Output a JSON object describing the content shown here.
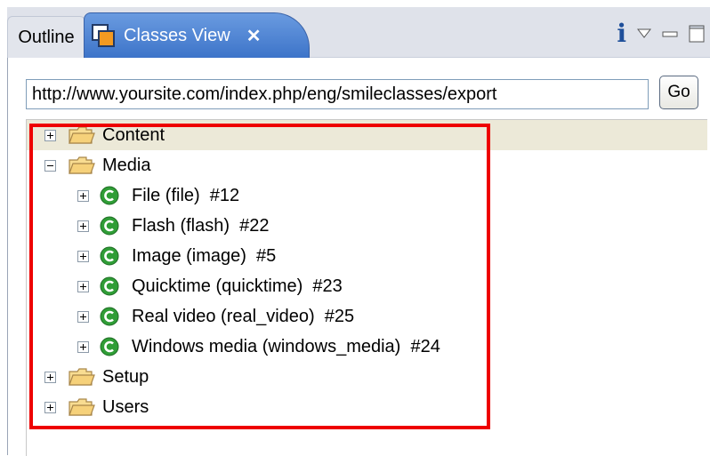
{
  "tabs": {
    "outline_label": "Outline",
    "active_label": "Classes View",
    "close_glyph": "✕"
  },
  "toolbar": {
    "info_glyph": "i",
    "icons": [
      "info-icon",
      "view-menu-icon",
      "minimize-icon",
      "maximize-icon"
    ]
  },
  "url": {
    "value": "http://www.yoursite.com/index.php/eng/smileclasses/export"
  },
  "go_label": "Go",
  "tree": {
    "content": "Content",
    "media": "Media",
    "children": [
      "File (file)  #12",
      "Flash (flash)  #22",
      "Image (image)  #5",
      "Quicktime (quicktime)  #23",
      "Real video (real_video)  #25",
      "Windows media (windows_media)  #24"
    ],
    "setup": "Setup",
    "users": "Users"
  },
  "colors": {
    "active_tab": "#4a80d2",
    "highlight": "#ee0000",
    "class_icon": "#2f9d36",
    "folder": "#f2c46a",
    "selected_row": "#ece9d8"
  }
}
